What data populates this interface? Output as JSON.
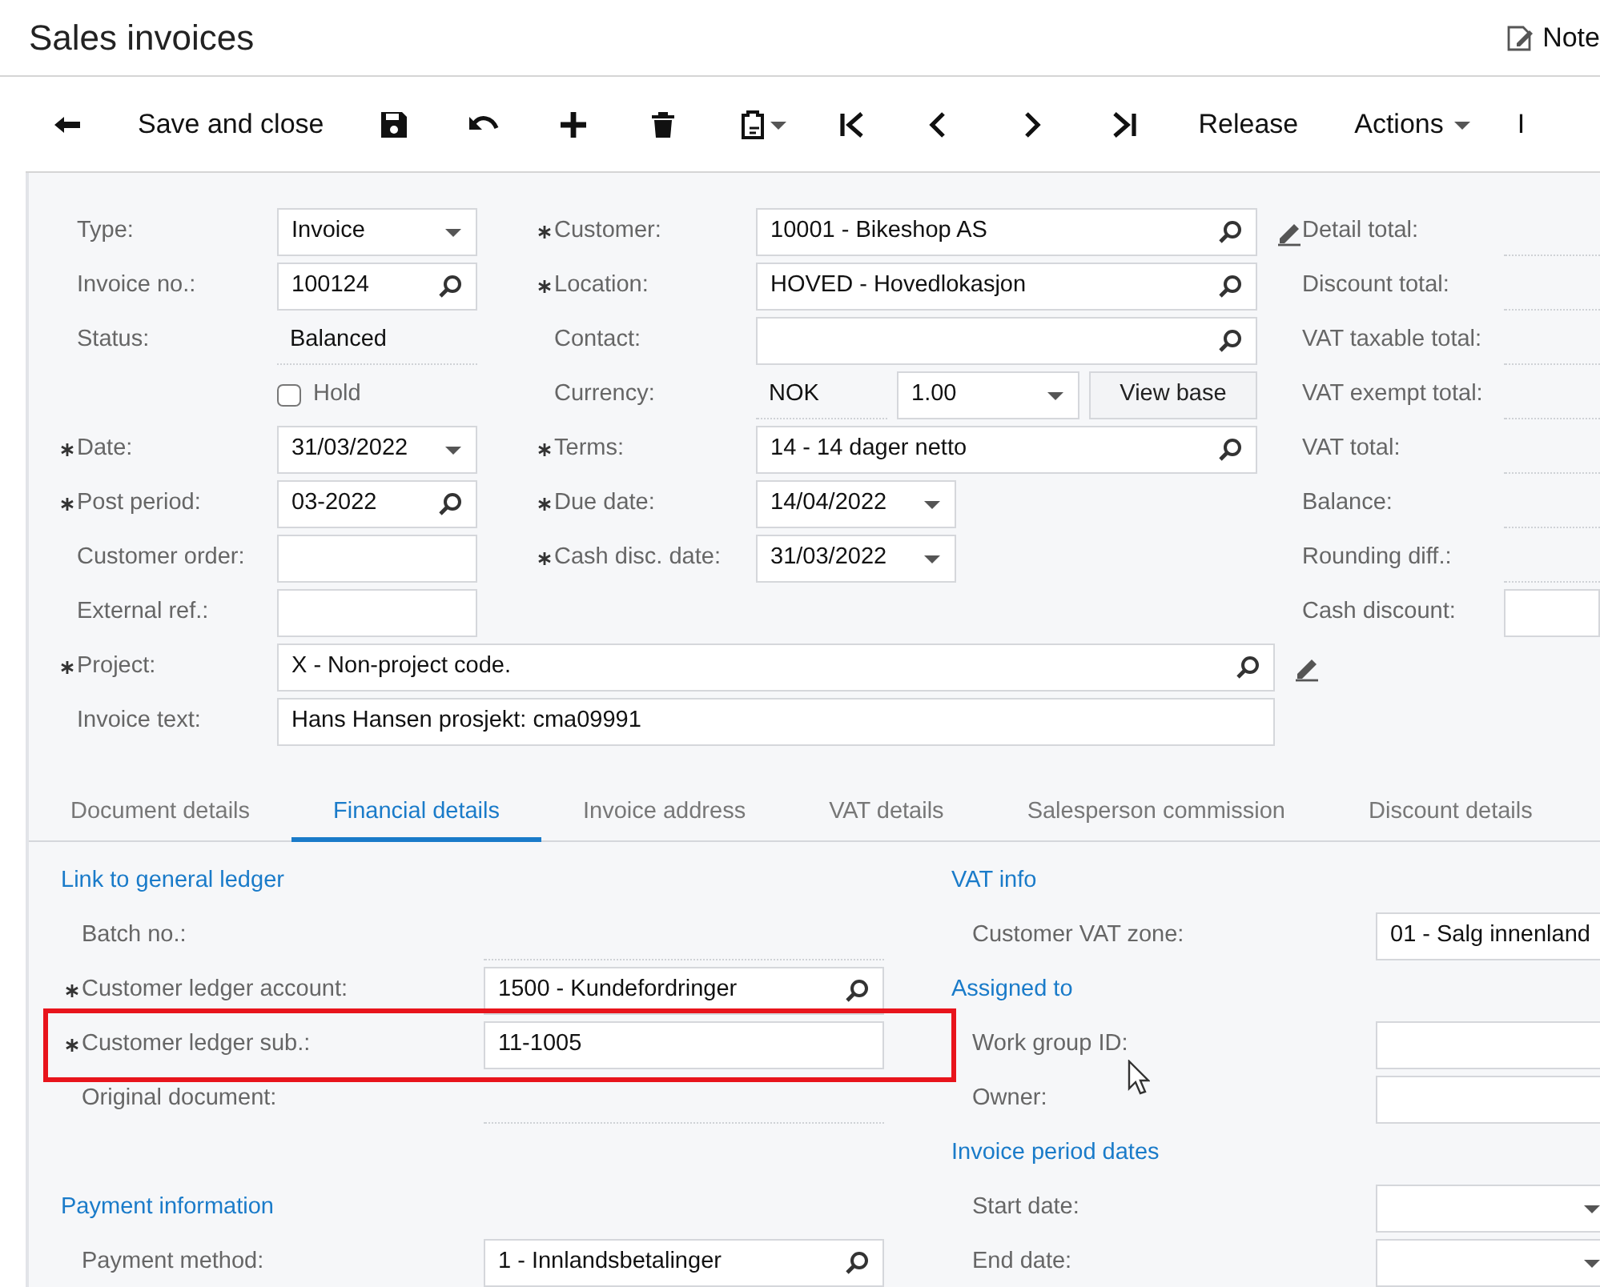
{
  "header": {
    "title": "Sales invoices",
    "notes": "Note"
  },
  "toolbar": {
    "save_close": "Save and close",
    "release": "Release",
    "actions": "Actions",
    "more": "I"
  },
  "form": {
    "col1": [
      {
        "label": "Type:",
        "required": false,
        "kind": "dropdown",
        "value": "Invoice"
      },
      {
        "label": "Invoice no.:",
        "required": false,
        "kind": "lookup",
        "value": "100124"
      },
      {
        "label": "Status:",
        "required": false,
        "kind": "static",
        "value": "Balanced"
      },
      {
        "label": "Hold",
        "required": false,
        "kind": "checkbox",
        "checked": false
      },
      {
        "label": "Date:",
        "required": true,
        "kind": "dropdown",
        "value": "31/03/2022"
      },
      {
        "label": "Post period:",
        "required": true,
        "kind": "lookup",
        "value": "03-2022"
      },
      {
        "label": "Customer order:",
        "required": false,
        "kind": "text"
      },
      {
        "label": "External ref.:",
        "required": false,
        "kind": "text"
      }
    ],
    "col2": [
      {
        "label": "Customer:",
        "required": true,
        "kind": "lookup",
        "value": "10001 - Bikeshop AS",
        "editable": true
      },
      {
        "label": "Location:",
        "required": true,
        "kind": "lookup",
        "value": "HOVED - Hovedlokasjon",
        "editable": false
      },
      {
        "label": "Contact:",
        "required": false,
        "kind": "lookup",
        "editable": false
      },
      {
        "label": "Currency:",
        "required": false,
        "kind": "currency",
        "value": "NOK",
        "rate": "1.00",
        "button": "View base",
        "editable": false
      },
      {
        "label": "Terms:",
        "required": true,
        "kind": "lookup",
        "value": "14 - 14 dager netto",
        "editable": false
      },
      {
        "label": "Due date:",
        "required": true,
        "kind": "dropdown",
        "value": "14/04/2022",
        "short": true,
        "editable": false
      },
      {
        "label": "Cash disc. date:",
        "required": true,
        "kind": "dropdown",
        "value": "31/03/2022",
        "short": true,
        "editable": false
      }
    ],
    "wide": [
      {
        "label": "Project:",
        "required": true,
        "kind": "lookup",
        "value": "X - Non-project code.",
        "editable": true
      },
      {
        "label": "Invoice text:",
        "required": false,
        "kind": "text",
        "value": "Hans Hansen prosjekt: cma09991",
        "editable": false
      }
    ],
    "totals": [
      {
        "label": "Detail total:",
        "kind": "static"
      },
      {
        "label": "Discount total:",
        "kind": "static"
      },
      {
        "label": "VAT taxable total:",
        "kind": "static"
      },
      {
        "label": "VAT exempt total:",
        "kind": "static"
      },
      {
        "label": "VAT total:",
        "kind": "static"
      },
      {
        "label": "Balance:",
        "kind": "static"
      },
      {
        "label": "Rounding diff.:",
        "kind": "static"
      },
      {
        "label": "Cash discount:",
        "kind": "text"
      }
    ]
  },
  "tabs": [
    {
      "label": "Document details",
      "selected": false
    },
    {
      "label": "Financial details",
      "selected": true
    },
    {
      "label": "Invoice address",
      "selected": false
    },
    {
      "label": "VAT details",
      "selected": false
    },
    {
      "label": "Salesperson commission",
      "selected": false
    },
    {
      "label": "Discount details",
      "selected": false
    }
  ],
  "details": {
    "left": [
      {
        "title": "Link to general ledger",
        "fields": [
          {
            "label": "Batch no.:",
            "required": false,
            "kind": "static",
            "highlighted": false
          },
          {
            "label": "Customer ledger account:",
            "required": true,
            "kind": "lookup",
            "value": "1500 - Kundefordringer",
            "highlighted": false
          },
          {
            "label": "Customer ledger sub.:",
            "required": true,
            "kind": "text",
            "value": "11-1005",
            "highlighted": true
          },
          {
            "label": "Original document:",
            "required": false,
            "kind": "static",
            "highlighted": false
          }
        ]
      },
      {
        "title": "Payment information",
        "fields": [
          {
            "label": "Payment method:",
            "required": false,
            "kind": "lookup",
            "value": "1 - Innlandsbetalinger",
            "highlighted": false
          }
        ]
      }
    ],
    "right": [
      {
        "title": "VAT info",
        "fields": [
          {
            "label": "Customer VAT zone:",
            "required": false,
            "kind": "text",
            "value": "01 - Salg innenland",
            "highlighted": false
          }
        ]
      },
      {
        "title": "Assigned to",
        "fields": [
          {
            "label": "Work group ID:",
            "required": false,
            "kind": "text",
            "highlighted": false
          },
          {
            "label": "Owner:",
            "required": false,
            "kind": "text",
            "highlighted": false
          }
        ]
      },
      {
        "title": "Invoice period dates",
        "fields": [
          {
            "label": "Start date:",
            "required": false,
            "kind": "dropdown",
            "highlighted": false
          },
          {
            "label": "End date:",
            "required": false,
            "kind": "dropdown",
            "highlighted": false
          }
        ]
      }
    ]
  }
}
